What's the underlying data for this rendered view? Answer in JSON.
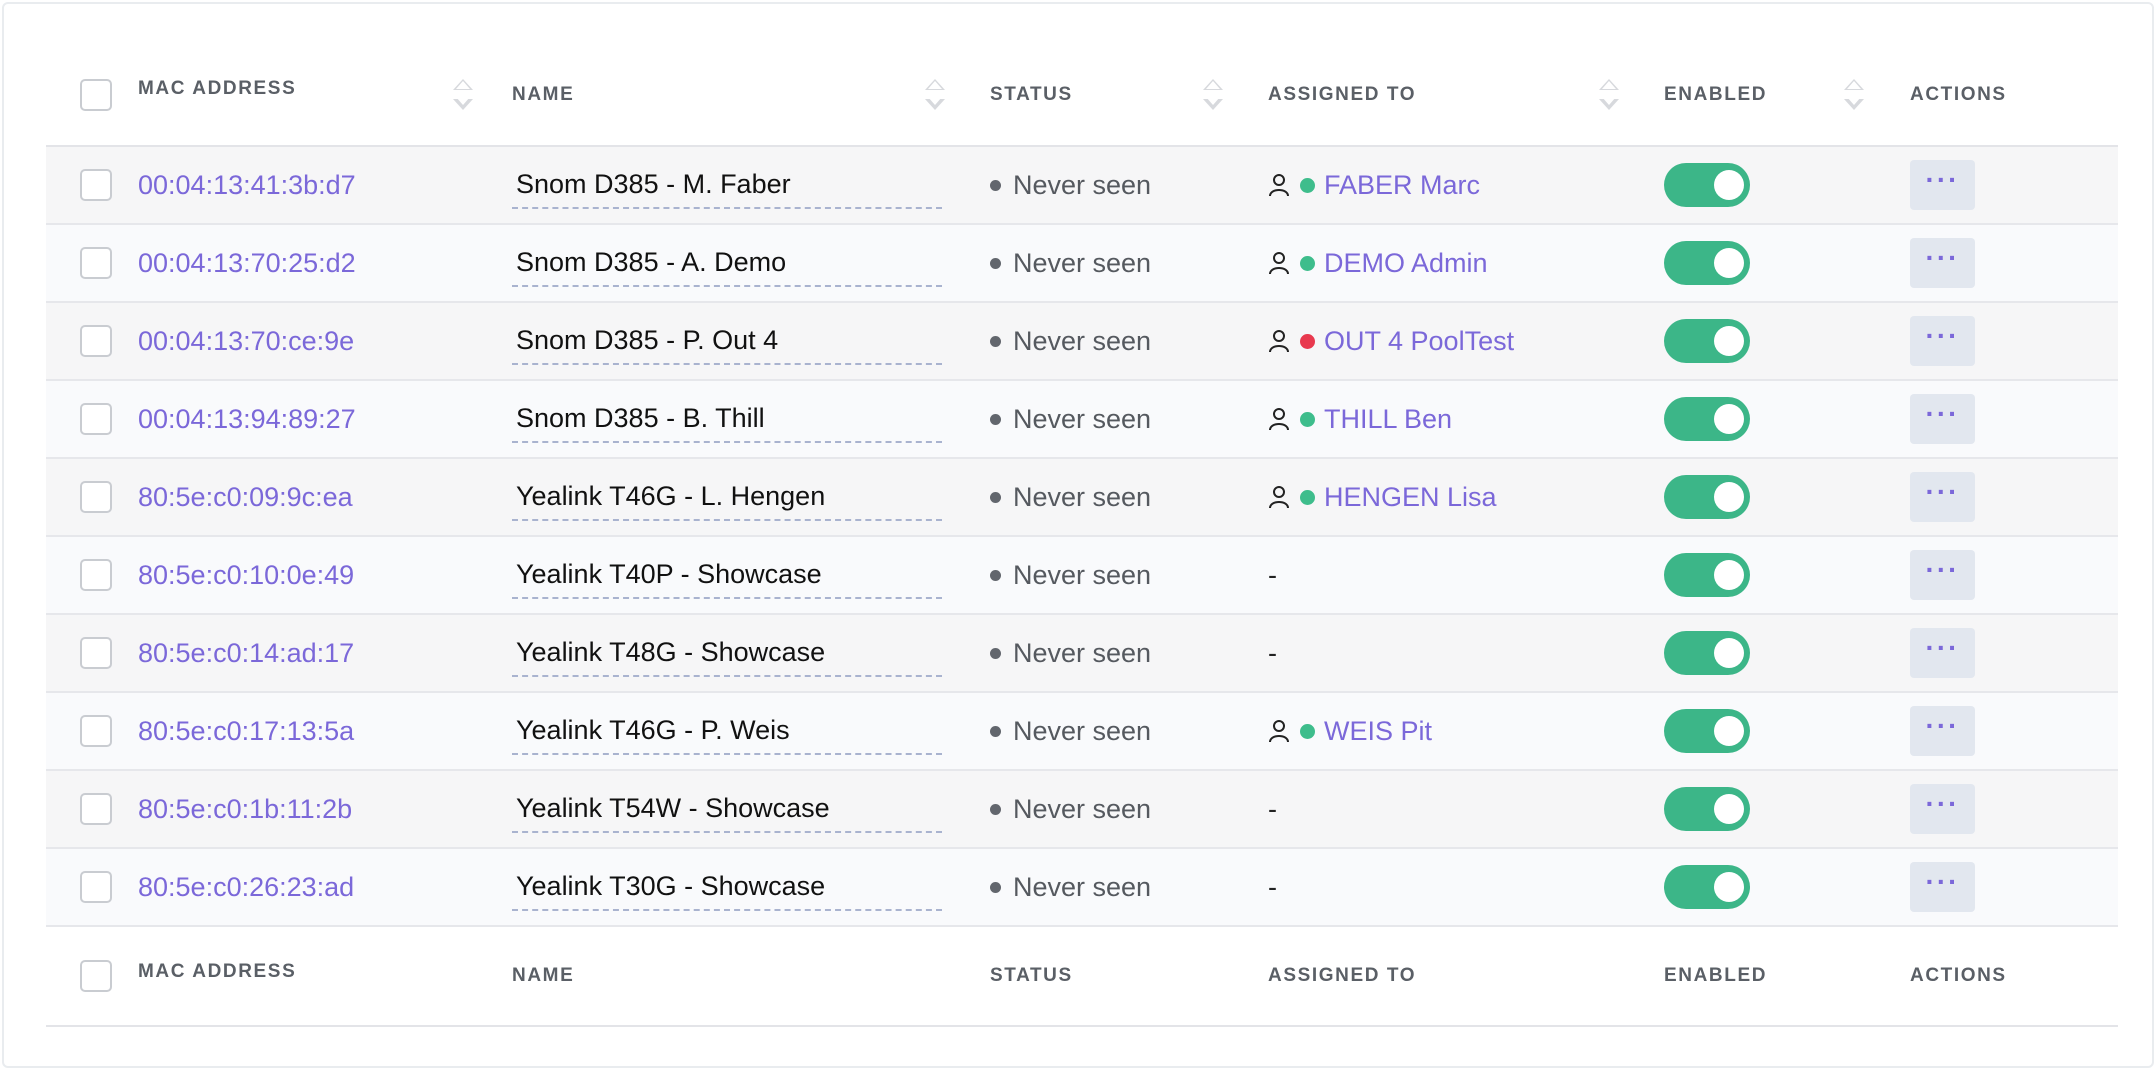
{
  "columns": {
    "mac": "MAC ADDRESS",
    "name": "NAME",
    "status": "STATUS",
    "assigned": "ASSIGNED TO",
    "enabled": "ENABLED",
    "actions": "ACTIONS"
  },
  "colors": {
    "link": "#7b68d9",
    "toggle_on": "#3cb688",
    "presence_online": "#3ebd8c",
    "presence_busy": "#e8394e"
  },
  "rows": [
    {
      "mac": "00:04:13:41:3b:d7",
      "name": "Snom D385 - M. Faber",
      "status": "Never seen",
      "assigned": "FABER Marc",
      "presence": "green",
      "enabled": true,
      "actions": "···"
    },
    {
      "mac": "00:04:13:70:25:d2",
      "name": "Snom D385 - A. Demo",
      "status": "Never seen",
      "assigned": "DEMO Admin",
      "presence": "green",
      "enabled": true,
      "actions": "···"
    },
    {
      "mac": "00:04:13:70:ce:9e",
      "name": "Snom D385 - P. Out 4",
      "status": "Never seen",
      "assigned": "OUT 4 PoolTest",
      "presence": "red",
      "enabled": true,
      "actions": "···"
    },
    {
      "mac": "00:04:13:94:89:27",
      "name": "Snom D385 - B. Thill",
      "status": "Never seen",
      "assigned": "THILL Ben",
      "presence": "green",
      "enabled": true,
      "actions": "···"
    },
    {
      "mac": "80:5e:c0:09:9c:ea",
      "name": "Yealink T46G - L. Hengen",
      "status": "Never seen",
      "assigned": "HENGEN Lisa",
      "presence": "green",
      "enabled": true,
      "actions": "···"
    },
    {
      "mac": "80:5e:c0:10:0e:49",
      "name": "Yealink T40P - Showcase",
      "status": "Never seen",
      "assigned": "-",
      "presence": "",
      "enabled": true,
      "actions": "···"
    },
    {
      "mac": "80:5e:c0:14:ad:17",
      "name": "Yealink T48G - Showcase",
      "status": "Never seen",
      "assigned": "-",
      "presence": "",
      "enabled": true,
      "actions": "···"
    },
    {
      "mac": "80:5e:c0:17:13:5a",
      "name": "Yealink T46G - P. Weis",
      "status": "Never seen",
      "assigned": "WEIS Pit",
      "presence": "green",
      "enabled": true,
      "actions": "···"
    },
    {
      "mac": "80:5e:c0:1b:11:2b",
      "name": "Yealink T54W - Showcase",
      "status": "Never seen",
      "assigned": "-",
      "presence": "",
      "enabled": true,
      "actions": "···"
    },
    {
      "mac": "80:5e:c0:26:23:ad",
      "name": "Yealink T30G - Showcase",
      "status": "Never seen",
      "assigned": "-",
      "presence": "",
      "enabled": true,
      "actions": "···"
    }
  ]
}
